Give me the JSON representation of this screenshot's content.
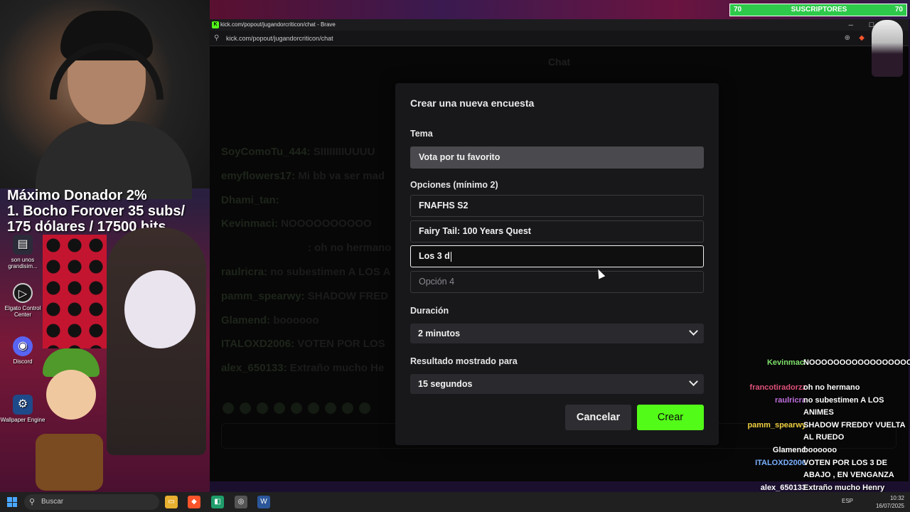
{
  "overlay": {
    "subs_left": "70",
    "subs_label": "SUSCRIPTORES",
    "subs_right": "70",
    "donor_lines": [
      "Máximo Donador 2%",
      "1. Bocho Forover 35 subs/",
      "175 dólares / 17500 bits"
    ],
    "desktop_icons": [
      {
        "label": "son unos grandisim...",
        "icon": "folder-icon"
      },
      {
        "label": "Elgato Control Center",
        "icon": "elgato-icon"
      },
      {
        "label": "Discord",
        "icon": "discord-icon"
      },
      {
        "label": "Wallpaper Engine",
        "icon": "wallpaper-engine-icon"
      }
    ]
  },
  "browser": {
    "window_title": "kick.com/popout/jugandorcriticon/chat - Brave",
    "url": "kick.com/popout/jugandorcriticon/chat",
    "page_title": "Chat"
  },
  "background_chat": [
    {
      "user": "SoyComoTu_444:",
      "msg": "SIIIIIIIIUUUU"
    },
    {
      "user": "emyflowers17:",
      "msg": "Mi bb va ser mad"
    },
    {
      "user": "Dhami_tan:",
      "msg": ""
    },
    {
      "user": "Kevinmaci:",
      "msg": "NOOOOOOOOOO"
    },
    {
      "user": "",
      "msg": ": oh no hermano"
    },
    {
      "user": "raulricra:",
      "msg": "no subestimen A LOS A"
    },
    {
      "user": "pamm_spearwy:",
      "msg": "SHADOW FRED"
    },
    {
      "user": "Glamend:",
      "msg": "boooooo"
    },
    {
      "user": "ITALOXD2006:",
      "msg": "VOTEN POR LOS"
    },
    {
      "user": "alex_650133:",
      "msg": "Extraño mucho He"
    }
  ],
  "modal": {
    "title": "Crear una nueva encuesta",
    "topic_label": "Tema",
    "topic_value": "Vota por tu favorito",
    "options_label": "Opciones (mínimo 2)",
    "option_1": "FNAFHS S2",
    "option_2": "Fairy Tail: 100 Years Quest",
    "option_3": "Los 3 d",
    "option_4_placeholder": "Opción 4",
    "duration_label": "Duración",
    "duration_value": "2 minutos",
    "result_label": "Resultado mostrado para",
    "result_value": "15 segundos",
    "cancel_label": "Cancelar",
    "create_label": "Crear"
  },
  "overlay_chat": [
    {
      "user": "Kevinmaci",
      "color": "#7ee06a",
      "msg": "NOOOOOOOOOOOOOOOOOOOOOOOO"
    },
    {
      "user": "francotiradorzz",
      "color": "#e0507a",
      "msg": "oh no hermano"
    },
    {
      "user": "raulricra",
      "color": "#c070e0",
      "msg": "no subestimen A LOS ANIMES"
    },
    {
      "user": "pamm_spearwy",
      "color": "#f0d040",
      "msg": "SHADOW FREDDY VUELTA AL RUEDO"
    },
    {
      "user": "Glamend",
      "color": "#ffffff",
      "msg": "boooooo"
    },
    {
      "user": "ITALOXD2006",
      "color": "#7ab0ff",
      "msg": "VOTEN POR LOS 3 DE ABAJO , EN VENGANZA"
    },
    {
      "user": "alex_650133",
      "color": "#ffffff",
      "msg": "Extraño mucho Henry danger"
    }
  ],
  "taskbar": {
    "search_label": "Buscar",
    "lang": "ESP",
    "time": "10:32",
    "date": "16/07/2025"
  }
}
